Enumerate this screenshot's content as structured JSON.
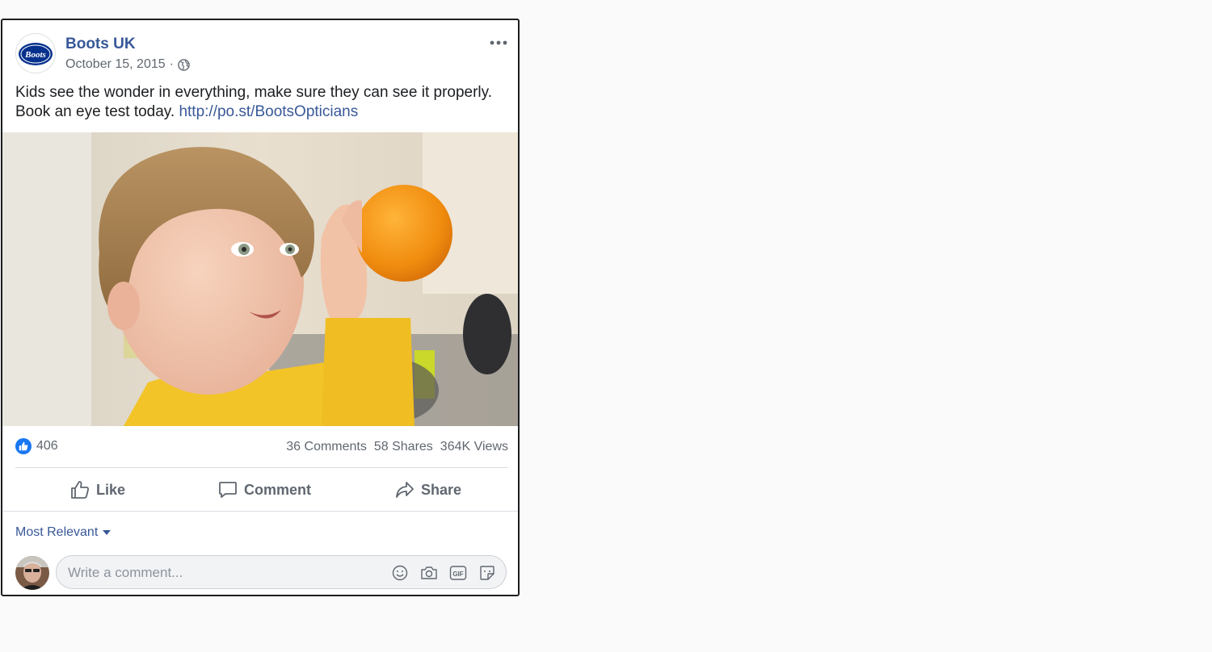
{
  "post": {
    "page_name": "Boots UK",
    "logo_text": "Boots",
    "date": "October 15, 2015",
    "separator": "·",
    "text_line1": "Kids see the wonder in everything, make sure they can see it properly.",
    "text_line2": "Book an eye test today.",
    "link": "http://po.st/BootsOpticians"
  },
  "stats": {
    "likes": "406",
    "comments": "36 Comments",
    "shares": "58 Shares",
    "views": "364K Views"
  },
  "actions": {
    "like": "Like",
    "comment": "Comment",
    "share": "Share"
  },
  "comments": {
    "sort_label": "Most Relevant",
    "placeholder": "Write a comment..."
  },
  "icons": [
    "globe-icon",
    "more-options-icon",
    "like-badge-icon",
    "thumbs-up-icon",
    "comment-icon",
    "share-icon",
    "caret-down-icon",
    "emoji-icon",
    "camera-icon",
    "gif-icon",
    "sticker-icon"
  ],
  "colors": {
    "link": "#385898",
    "like_blue": "#1877f2",
    "text": "#1c1e21",
    "secondary": "#606770",
    "border": "#1c1e21"
  }
}
